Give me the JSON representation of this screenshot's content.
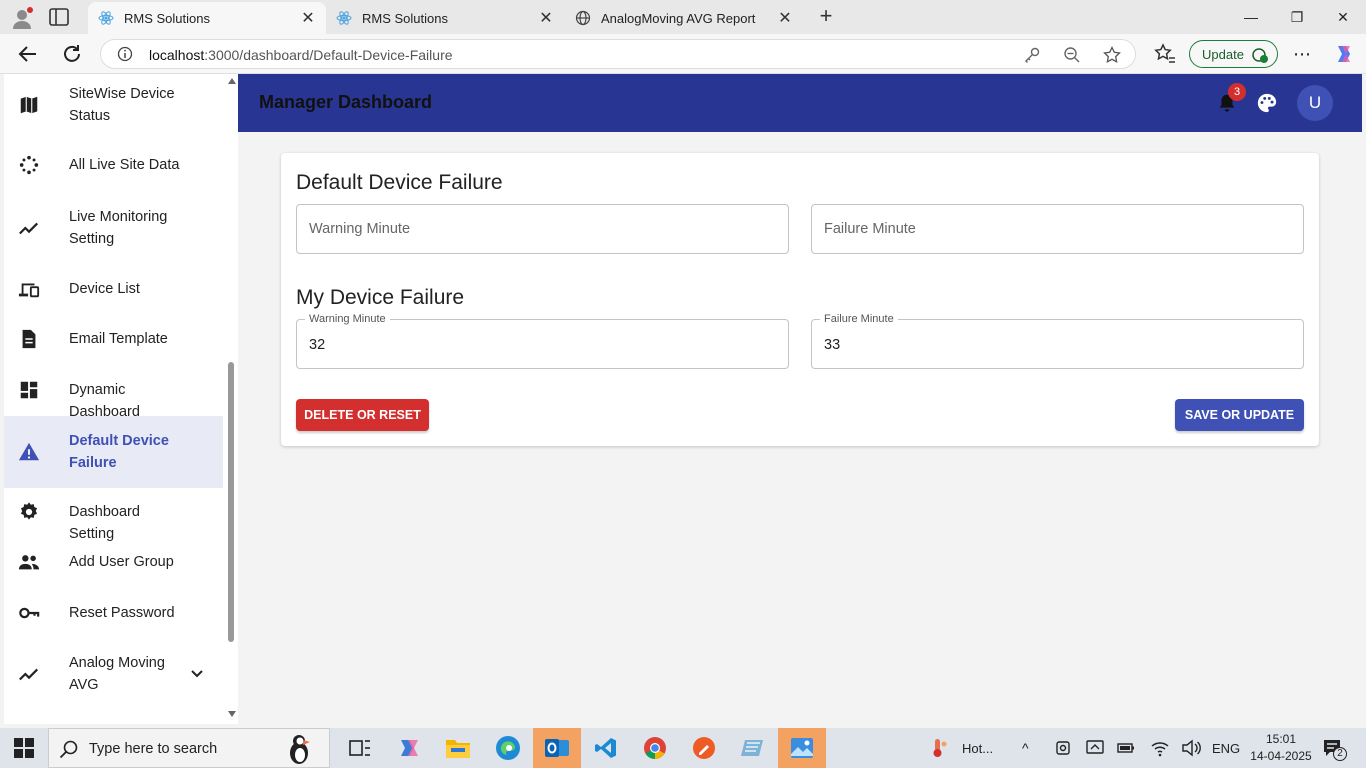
{
  "browser": {
    "tabs": [
      {
        "title": "RMS Solutions",
        "active": true
      },
      {
        "title": "RMS Solutions",
        "active": false
      },
      {
        "title": "AnalogMoving AVG Report",
        "active": false
      }
    ],
    "url_host": "localhost",
    "url_path": ":3000/dashboard/Default-Device-Failure",
    "update_label": "Update"
  },
  "sidebar": {
    "items": [
      {
        "label": "SiteWise Device Status",
        "icon": "map-icon"
      },
      {
        "label": "All Live Site Data",
        "icon": "scatter-icon"
      },
      {
        "label": "Live Monitoring Setting",
        "icon": "trend-icon"
      },
      {
        "label": "Device List",
        "icon": "devices-icon"
      },
      {
        "label": "Email Template",
        "icon": "document-icon"
      },
      {
        "label": "Dynamic Dashboard",
        "icon": "dashboard-icon"
      },
      {
        "label": "Default Device Failure",
        "icon": "warning-icon",
        "active": true
      },
      {
        "label": "Dashboard Setting",
        "icon": "gear-icon"
      },
      {
        "label": "Add User Group",
        "icon": "group-icon"
      },
      {
        "label": "Reset Password",
        "icon": "key-icon"
      },
      {
        "label": "Analog Moving AVG",
        "icon": "trend-icon"
      }
    ]
  },
  "header": {
    "title": "Manager Dashboard",
    "notification_count": "3",
    "avatar_initial": "U"
  },
  "main": {
    "default_section_title": "Default Device Failure",
    "default_warning_placeholder": "Warning Minute",
    "default_failure_placeholder": "Failure Minute",
    "my_section_title": "My Device Failure",
    "my_warning_label": "Warning Minute",
    "my_warning_value": "32",
    "my_failure_label": "Failure Minute",
    "my_failure_value": "33",
    "delete_label": "DELETE OR RESET",
    "save_label": "SAVE OR UPDATE"
  },
  "taskbar": {
    "search_placeholder": "Type here to search",
    "weather_text": "Hot...",
    "language": "ENG",
    "time": "15:01",
    "date": "14-04-2025",
    "notification_count": "2"
  },
  "colors": {
    "primary": "#3f51b5",
    "appbar": "#283593",
    "danger": "#d32f2f",
    "active_bg": "#e8eaf6"
  }
}
